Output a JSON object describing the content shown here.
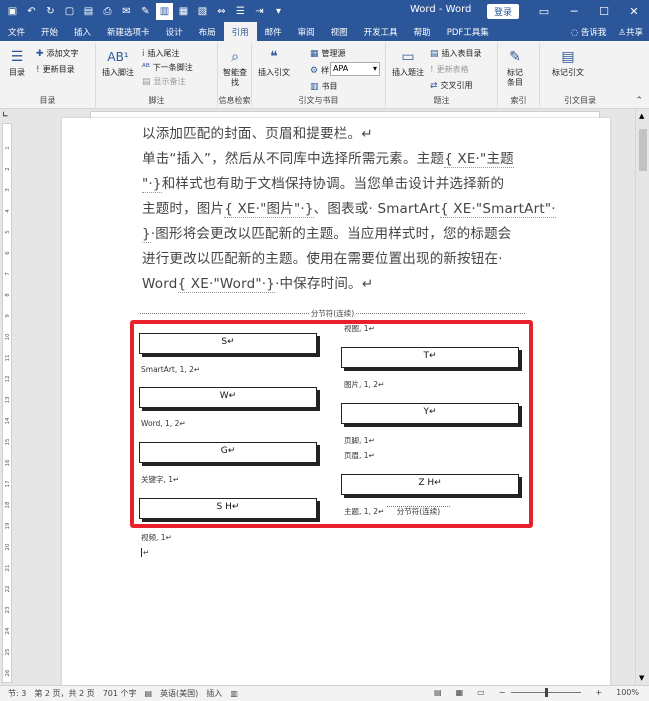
{
  "titlebar": {
    "doc_title": "Word - Word",
    "login": "登录",
    "qat_icons": [
      "save-icon",
      "undo-icon",
      "redo-icon",
      "new-doc-icon",
      "open-icon",
      "print-preview-icon",
      "email-icon",
      "format-painter-icon",
      "table-icon",
      "page-layout-icon",
      "image-icon",
      "spacing-icon",
      "bullet-icon",
      "indent-icon",
      "customize-icon"
    ]
  },
  "tabs": [
    "文件",
    "开始",
    "插入",
    "新建选项卡",
    "设计",
    "布局",
    "引用",
    "邮件",
    "审阅",
    "视图",
    "开发工具",
    "帮助",
    "PDF工具集"
  ],
  "active_tab": "引用",
  "tabs_right": {
    "tell": "告诉我",
    "share": "共享"
  },
  "ribbon": {
    "toc": {
      "button": "目录",
      "add_text": "添加文字",
      "update": "更新目录",
      "group": "目录"
    },
    "footnote": {
      "insert": "插入脚注",
      "insert_endnote": "插入尾注",
      "next": "下一条脚注",
      "show": "显示备注",
      "group": "脚注"
    },
    "research": {
      "smart": "智能查找",
      "group": "信息检索"
    },
    "citations": {
      "insert": "插入引文",
      "manage": "管理源",
      "style_label": "样式:",
      "style_value": "APA",
      "bib": "书目",
      "group": "引文与书目"
    },
    "captions": {
      "insert": "插入题注",
      "table_of_figures": "插入表目录",
      "update": "更新表格",
      "cross_ref": "交叉引用",
      "group": "题注"
    },
    "index": {
      "mark": "标记条目",
      "group": "索引"
    },
    "toa": {
      "mark": "标记引文",
      "group": "引文目录"
    }
  },
  "document": {
    "line0": "以添加匹配的封面、页眉和提要栏。↵",
    "line1a": "单击“插入”，然后从不同库中选择所需元素。主题",
    "line1f": "{ XE·\"主题",
    "line2f": "\"·}",
    "line2b": "和样式也有助于文档保持协调。当您单击设计并选择新的",
    "line3a": "主题时，图片",
    "line3f1": "{ XE·\"图片\"·}",
    "line3b": "、图表或· SmartArt",
    "line3f2": "{ XE·\"SmartArt\"·",
    "line4f": "}",
    "line4b": "·图形将会更改以匹配新的主题。当应用样式时，您的标题会",
    "line5": "进行更改以匹配新的主题。使用在需要位置出现的新按钮在·",
    "line6a": "Word",
    "line6f": "{ XE·\"Word\"·}",
    "line6b": "·中保存时间。↵",
    "section_break": "分节符(连续)",
    "index_left": [
      {
        "head": "S↵",
        "entry": "SmartArt, 1, 2↵"
      },
      {
        "head": "W↵",
        "entry": "Word, 1, 2↵"
      },
      {
        "head": "G↵",
        "entry": "关键字, 1↵"
      },
      {
        "head": "S H↵",
        "entry": ""
      }
    ],
    "index_right_top": "视图, 1↵",
    "index_right": [
      {
        "head": "T↵",
        "entry": "图片, 1, 2↵"
      },
      {
        "head": "Y↵",
        "entry": "页脚, 1↵",
        "entry2": "页眉, 1↵"
      },
      {
        "head": "Z H↵",
        "entry": "主题, 1, 2↵"
      }
    ],
    "after_index": "视频, 1↵",
    "cursor_line": "↵"
  },
  "status": {
    "section": "节: 3",
    "page": "第 2 页，共 2 页",
    "words": "701 个字",
    "lang": "英语(美国)",
    "mode": "插入",
    "zoom": "100%",
    "zoom_percent": 100
  }
}
